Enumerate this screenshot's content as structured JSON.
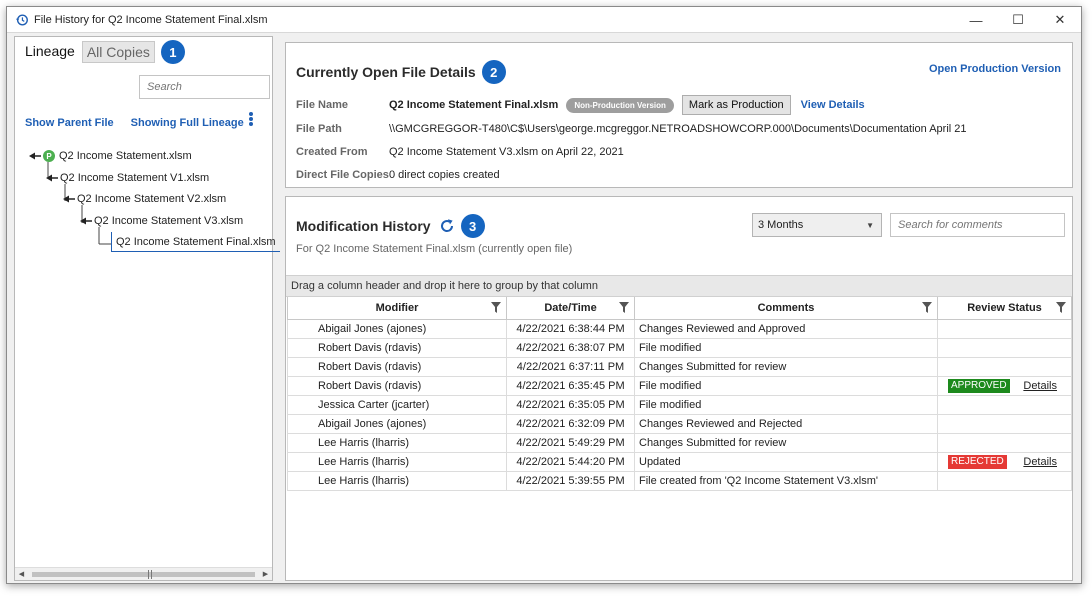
{
  "window": {
    "title": "File History for Q2 Income Statement Final.xlsm",
    "minimize": "—",
    "maximize": "☐",
    "close": "✕"
  },
  "left": {
    "tabs": [
      {
        "label": "Lineage"
      },
      {
        "label": "All Copies"
      }
    ],
    "badge": "1",
    "search_placeholder": "Search",
    "show_parent": "Show Parent File",
    "showing_full": "Showing Full Lineage",
    "tree": [
      {
        "label": "Q2 Income Statement.xlsm",
        "badge": "P"
      },
      {
        "label": "Q2 Income Statement V1.xlsm"
      },
      {
        "label": "Q2 Income Statement V2.xlsm"
      },
      {
        "label": "Q2 Income Statement V3.xlsm"
      },
      {
        "label": "Q2 Income Statement Final.xlsm"
      }
    ]
  },
  "details": {
    "title": "Currently Open File Details",
    "badge": "2",
    "open_production": "Open Production Version",
    "labels": {
      "file_name": "File Name",
      "file_path": "File Path",
      "created_from": "Created From",
      "direct_copies": "Direct File Copies"
    },
    "file_name": "Q2 Income Statement Final.xlsm",
    "pill": "Non-Production Version",
    "mark_production": "Mark as Production",
    "view_details": "View Details",
    "file_path": "\\\\GMCGREGGOR-T480\\C$\\Users\\george.mcgreggor.NETROADSHOWCORP.000\\Documents\\Documentation April 21",
    "created_from": "Q2 Income Statement V3.xlsm on April 22, 2021",
    "direct_copies": "0 direct copies created"
  },
  "history": {
    "title": "Modification History",
    "badge": "3",
    "subtitle": "For Q2 Income Statement Final.xlsm (currently open file)",
    "range": "3 Months",
    "comment_placeholder": "Search for comments",
    "group_hint": "Drag a column header and drop it here to group by that column",
    "columns": [
      "Modifier",
      "Date/Time",
      "Comments",
      "Review Status"
    ],
    "rows": [
      {
        "modifier": "Abigail Jones (ajones)",
        "datetime": "4/22/2021 6:38:44 PM",
        "comment": "Changes Reviewed and Approved",
        "status": "",
        "details": ""
      },
      {
        "modifier": "Robert Davis (rdavis)",
        "datetime": "4/22/2021 6:38:07 PM",
        "comment": "File modified",
        "status": "",
        "details": ""
      },
      {
        "modifier": "Robert Davis (rdavis)",
        "datetime": "4/22/2021 6:37:11 PM",
        "comment": "Changes Submitted for review",
        "status": "",
        "details": ""
      },
      {
        "modifier": "Robert Davis (rdavis)",
        "datetime": "4/22/2021 6:35:45 PM",
        "comment": "File modified",
        "status": "APPROVED",
        "details": "Details"
      },
      {
        "modifier": "Jessica  Carter (jcarter)",
        "datetime": "4/22/2021 6:35:05 PM",
        "comment": "File modified",
        "status": "",
        "details": ""
      },
      {
        "modifier": "Abigail Jones (ajones)",
        "datetime": "4/22/2021 6:32:09 PM",
        "comment": "Changes Reviewed and Rejected",
        "status": "",
        "details": ""
      },
      {
        "modifier": "Lee Harris (lharris)",
        "datetime": "4/22/2021 5:49:29 PM",
        "comment": "Changes Submitted for review",
        "status": "",
        "details": ""
      },
      {
        "modifier": "Lee Harris (lharris)",
        "datetime": "4/22/2021 5:44:20 PM",
        "comment": "Updated",
        "status": "REJECTED",
        "details": "Details"
      },
      {
        "modifier": "Lee Harris (lharris)",
        "datetime": "4/22/2021 5:39:55 PM",
        "comment": "File created from 'Q2 Income Statement V3.xlsm'",
        "status": "",
        "details": ""
      }
    ]
  },
  "colors": {
    "accent": "#1565c0",
    "link": "#1f5fb4",
    "approved": "#1d8a1d",
    "rejected": "#e53935",
    "production_badge": "#4caf50"
  }
}
